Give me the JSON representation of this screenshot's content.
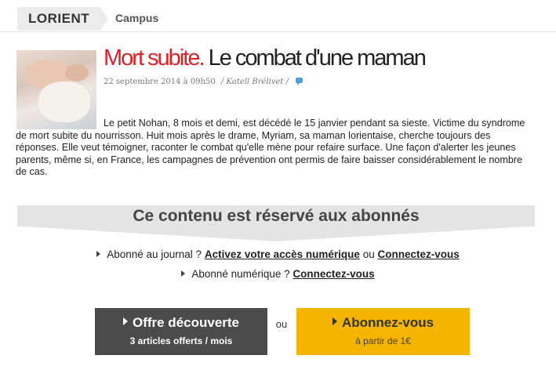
{
  "breadcrumb": {
    "city": "LORIENT",
    "section": "Campus"
  },
  "article": {
    "title_red": "Mort subite.",
    "title_rest": "Le combat d'une maman",
    "date": "22 septembre 2014 à 09h50",
    "author": "/ Katell Brélivet /",
    "lead": "Le petit Nohan, 8 mois et demi, est décédé le 15 janvier pendant sa sieste. Victime du syndrome de mort subite du nourrisson. Huit mois après le drame, Myriam, sa maman lorientaise, cherche toujours des réponses. Elle veut témoigner, raconter le combat qu'elle mène pour refaire surface. Une façon d'alerter les jeunes parents, même si, en France, les campagnes de prévention ont permis de faire baisser considérablement le nombre de cas."
  },
  "paywall": {
    "banner": "Ce contenu est réservé aux abonnés",
    "line1_prefix": "Abonné au journal ?",
    "line1_link1": "Activez votre accès numérique",
    "line1_or": "ou",
    "line1_link2": "Connectez-vous",
    "line2_prefix": "Abonné numérique ?",
    "line2_link": "Connectez-vous"
  },
  "offers": {
    "discover_title": "Offre découverte",
    "discover_sub": "3 articles offerts / mois",
    "or": "ou",
    "subscribe_title": "Abonnez-vous",
    "subscribe_sub": "à partir de 1€"
  },
  "colors": {
    "accent_red": "#d8232a",
    "gold": "#f5b400",
    "dark": "#4b4b4b",
    "comment_blue": "#4aa3df"
  },
  "icons": [
    "comment-icon",
    "arrow-right-icon"
  ]
}
